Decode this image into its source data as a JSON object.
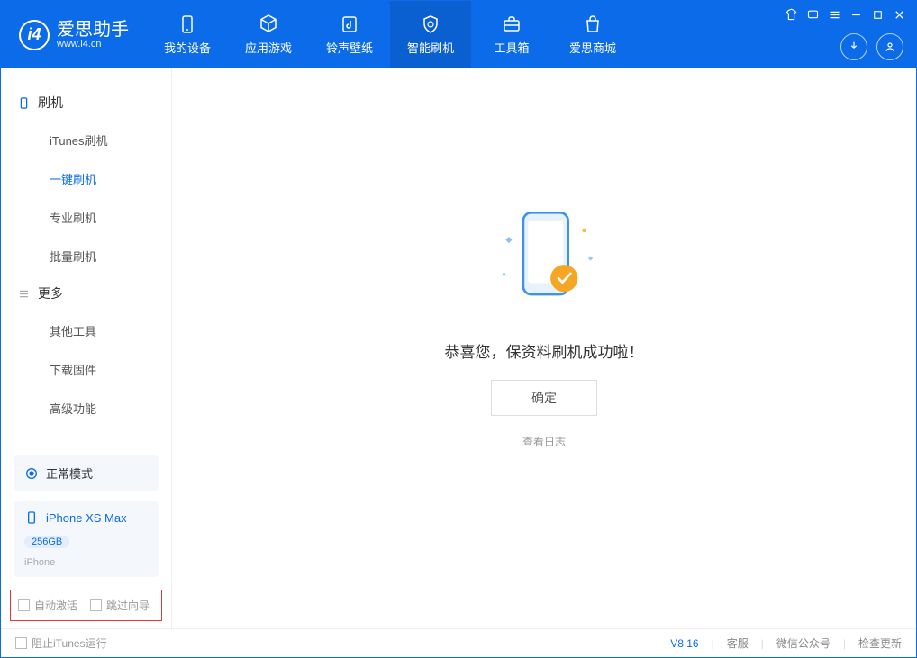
{
  "app": {
    "name": "爱思助手",
    "url": "www.i4.cn"
  },
  "nav": {
    "mydevice": "我的设备",
    "apps": "应用游戏",
    "rings": "铃声壁纸",
    "flash": "智能刷机",
    "toolbox": "工具箱",
    "store": "爱思商城"
  },
  "sidebar": {
    "section_flash": "刷机",
    "itunes_flash": "iTunes刷机",
    "onekey_flash": "一键刷机",
    "pro_flash": "专业刷机",
    "batch_flash": "批量刷机",
    "section_more": "更多",
    "other_tools": "其他工具",
    "download_fw": "下载固件",
    "advanced": "高级功能",
    "mode": "正常模式",
    "device_name": "iPhone XS Max",
    "device_capacity": "256GB",
    "device_type": "iPhone",
    "auto_activate": "自动激活",
    "skip_guide": "跳过向导"
  },
  "main": {
    "success_msg": "恭喜您，保资料刷机成功啦！",
    "ok": "确定",
    "view_log": "查看日志"
  },
  "statusbar": {
    "block_itunes": "阻止iTunes运行",
    "version": "V8.16",
    "support": "客服",
    "wechat": "微信公众号",
    "check_update": "检查更新"
  }
}
